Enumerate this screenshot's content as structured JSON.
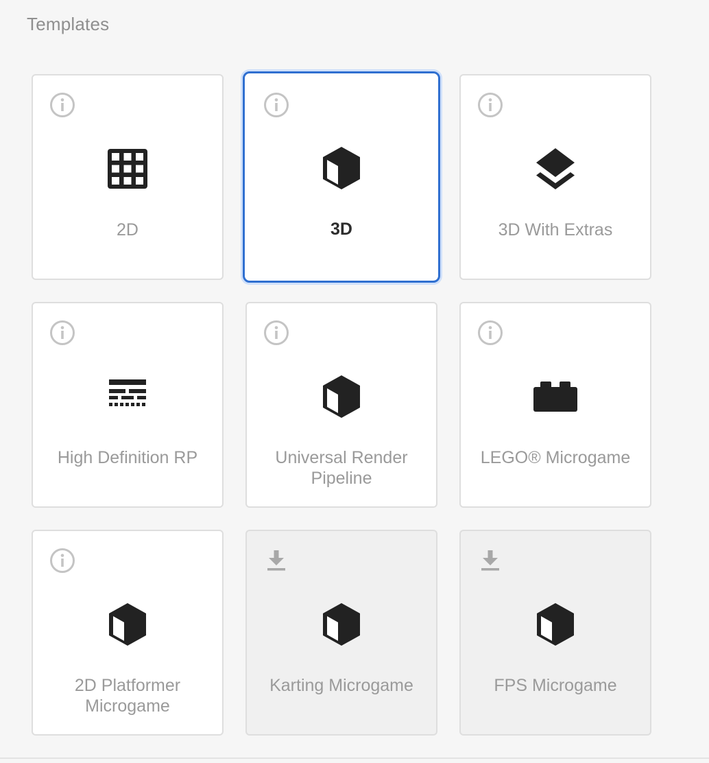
{
  "section": {
    "title": "Templates"
  },
  "colors": {
    "selected_border": "#2f6fd0",
    "label_muted": "#9a9a9a",
    "label_selected": "#2d2d2d"
  },
  "templates": [
    {
      "label": "2D",
      "icon": "grid-icon",
      "corner_icon": "info-icon",
      "selected": false,
      "downloadable": false
    },
    {
      "label": "3D",
      "icon": "cube-icon",
      "corner_icon": "info-icon",
      "selected": true,
      "downloadable": false
    },
    {
      "label": "3D With Extras",
      "icon": "layers-icon",
      "corner_icon": "info-icon",
      "selected": false,
      "downloadable": false
    },
    {
      "label": "High Definition RP",
      "icon": "lines-icon",
      "corner_icon": "info-icon",
      "selected": false,
      "downloadable": false
    },
    {
      "label": "Universal Render Pipeline",
      "icon": "cube-icon",
      "corner_icon": "info-icon",
      "selected": false,
      "downloadable": false
    },
    {
      "label": "LEGO® Microgame",
      "icon": "lego-brick-icon",
      "corner_icon": "info-icon",
      "selected": false,
      "downloadable": false
    },
    {
      "label": "2D Platformer Microgame",
      "icon": "cube-icon",
      "corner_icon": "info-icon",
      "selected": false,
      "downloadable": false
    },
    {
      "label": "Karting Microgame",
      "icon": "cube-icon",
      "corner_icon": "download-icon",
      "selected": false,
      "downloadable": true
    },
    {
      "label": "FPS Microgame",
      "icon": "cube-icon",
      "corner_icon": "download-icon",
      "selected": false,
      "downloadable": true
    }
  ]
}
